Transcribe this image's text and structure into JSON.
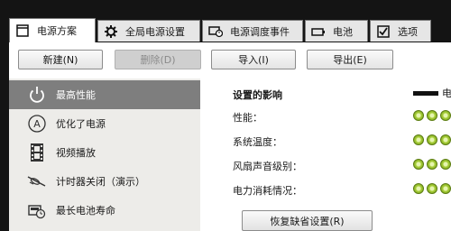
{
  "tabs": [
    {
      "label": "电源方案",
      "icon": "document-icon"
    },
    {
      "label": "全局电源设置",
      "icon": "gear-icon"
    },
    {
      "label": "电源调度事件",
      "icon": "clock-screen-icon"
    },
    {
      "label": "电池",
      "icon": "battery-icon"
    },
    {
      "label": "选项",
      "icon": "checkbox-icon"
    }
  ],
  "toolbar": {
    "new_label": "新建(N)",
    "delete_label": "删除(D)",
    "import_label": "导入(I)",
    "export_label": "导出(E)"
  },
  "plans": [
    {
      "label": "最高性能",
      "icon": "power-icon",
      "selected": true
    },
    {
      "label": "优化了电源",
      "icon": "auto-a-icon",
      "selected": false
    },
    {
      "label": "视频播放",
      "icon": "film-icon",
      "selected": false
    },
    {
      "label": "计时器关闭（演示）",
      "icon": "pen-icon",
      "selected": false
    },
    {
      "label": "最长电池寿命",
      "icon": "monitor-clock-icon",
      "selected": false
    }
  ],
  "detail": {
    "title": "设置的影响",
    "legend_label": "电",
    "rows": [
      {
        "label": "性能：",
        "level": 3
      },
      {
        "label": "系统温度：",
        "level": 3
      },
      {
        "label": "风扇声音级别：",
        "level": 3
      },
      {
        "label": "电力消耗情况：",
        "level": 3
      }
    ],
    "restore_label": "恢复缺省设置(R)"
  },
  "colors": {
    "background": "#141414",
    "selected_item": "#7e7e7e",
    "indicator_green": "#a9cf3a"
  }
}
